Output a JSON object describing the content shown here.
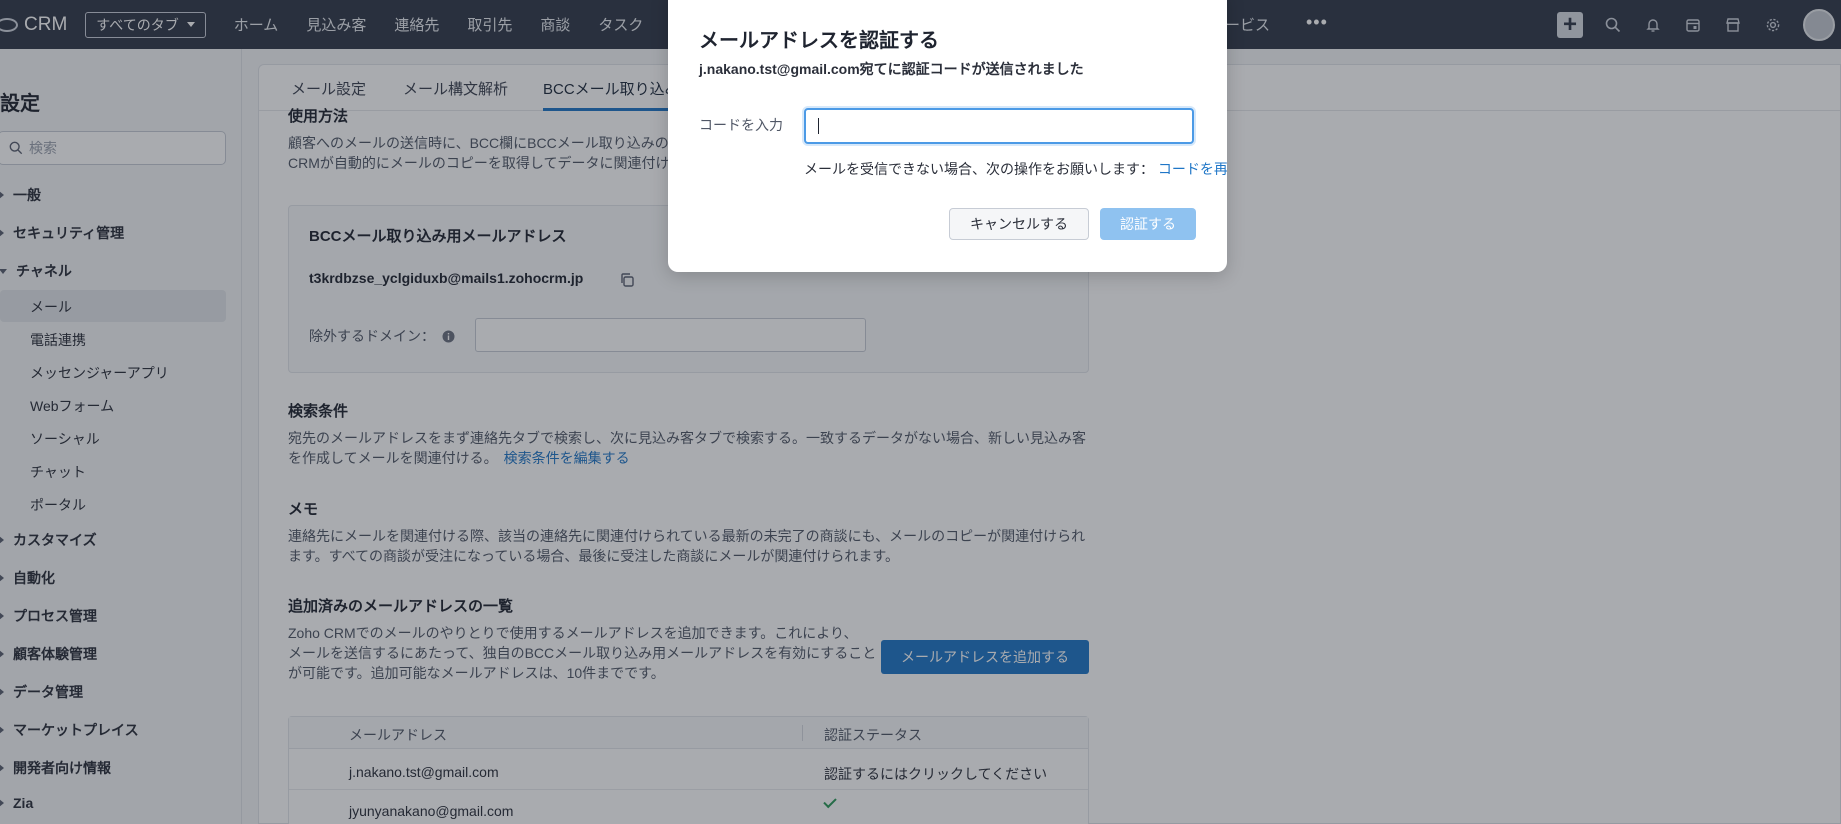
{
  "topnav": {
    "app_name": "CRM",
    "tabs_select": "すべてのタブ",
    "items": [
      "ホーム",
      "見込み客",
      "連絡先",
      "取引先",
      "商談",
      "タスク"
    ],
    "hidden_item": "ービス",
    "more": "•••",
    "plus": "+"
  },
  "sidebar": {
    "title": "設定",
    "search_placeholder": "検索",
    "items": [
      {
        "label": "一般",
        "type": "group"
      },
      {
        "label": "セキュリティ管理",
        "type": "group"
      },
      {
        "label": "チャネル",
        "type": "group-open"
      },
      {
        "label": "メール",
        "type": "sub-active"
      },
      {
        "label": "電話連携",
        "type": "sub"
      },
      {
        "label": "メッセンジャーアプリ",
        "type": "sub"
      },
      {
        "label": "Webフォーム",
        "type": "sub"
      },
      {
        "label": "ソーシャル",
        "type": "sub"
      },
      {
        "label": "チャット",
        "type": "sub"
      },
      {
        "label": "ポータル",
        "type": "sub"
      },
      {
        "label": "カスタマイズ",
        "type": "group"
      },
      {
        "label": "自動化",
        "type": "group"
      },
      {
        "label": "プロセス管理",
        "type": "group"
      },
      {
        "label": "顧客体験管理",
        "type": "group"
      },
      {
        "label": "データ管理",
        "type": "group"
      },
      {
        "label": "マーケットプレイス",
        "type": "group"
      },
      {
        "label": "開発者向け情報",
        "type": "group"
      },
      {
        "label": "Zia",
        "type": "group"
      }
    ]
  },
  "main": {
    "tabs": [
      "メール設定",
      "メール構文解析",
      "BCCメール取り込み"
    ],
    "usage_heading": "使用方法",
    "usage_line1": "顧客へのメールの送信時に、BCC欄にBCCメール取り込みの",
    "usage_line2": "CRMが自動的にメールのコピーを取得してデータに関連付け",
    "bcc_title": "BCCメール取り込み用メールアドレス",
    "bcc_address": "t3krdbzse_yclgiduxb@mails1.zohocrm.jp",
    "exclude_label": "除外するドメイン：",
    "exclude_value": "",
    "search_heading": "検索条件",
    "search_line1": "宛先のメールアドレスをまず連絡先タブで検索し、次に見込み客タブで検索する。一致するデータがない場合、新しい見込み客",
    "search_line2": "を作成してメールを関連付ける。",
    "search_link": "検索条件を編集する",
    "memo_heading": "メモ",
    "memo_line1": "連絡先にメールを関連付ける際、該当の連絡先に関連付けられている最新の未完了の商談にも、メールのコピーが関連付けられ",
    "memo_line2": "ます。すべての商談が受注になっている場合、最後に受注した商談にメールが関連付けられます。",
    "added_heading": "追加済みのメールアドレスの一覧",
    "added_line1": "Zoho CRMでのメールのやりとりで使用するメールアドレスを追加できます。これにより、",
    "added_line2": "メールを送信するにあたって、独自のBCCメール取り込み用メールアドレスを有効にすること",
    "added_line3": "が可能です。追加可能なメールアドレスは、10件までです。",
    "add_button": "メールアドレスを追加する",
    "table": {
      "headers": [
        "メールアドレス",
        "認証ステータス"
      ],
      "rows": [
        {
          "email": "j.nakano.tst@gmail.com",
          "status": "認証するにはクリックしてください"
        },
        {
          "email": "jyunyanakano@gmail.com",
          "status": "verified"
        }
      ]
    }
  },
  "modal": {
    "title": "メールアドレスを認証する",
    "subtitle": "j.nakano.tst@gmail.com宛てに認証コードが送信されました",
    "code_label": "コードを入力",
    "code_value": "",
    "help_text": "メールを受信できない場合、次の操作をお願いします：",
    "help_link": "コードを再",
    "cancel_button": "キャンセルする",
    "verify_button": "認証する"
  },
  "colors": {
    "topnav_bg": "#313949",
    "accent": "#1f76c7",
    "verify_disabled": "#8fc2f0",
    "success": "#2d9a5a"
  }
}
